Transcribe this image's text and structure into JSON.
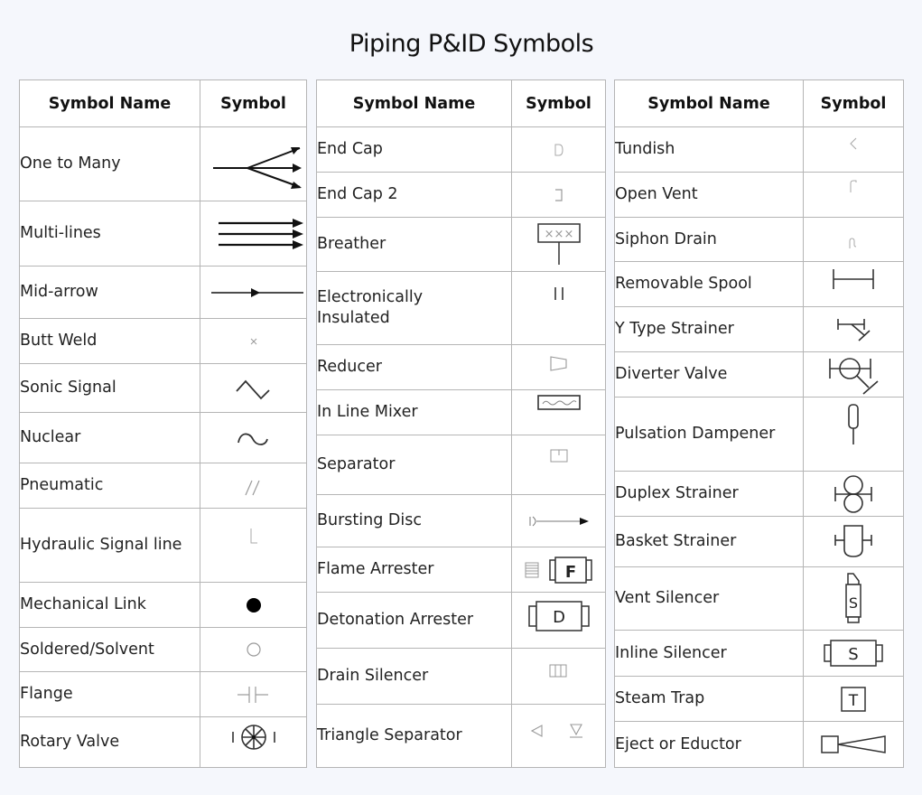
{
  "title": "Piping P&ID Symbols",
  "headers": {
    "name": "Symbol Name",
    "symbol": "Symbol"
  },
  "tables": [
    {
      "rows": [
        {
          "name": "One to Many",
          "icon": "one-to-many-icon"
        },
        {
          "name": "Multi-lines",
          "icon": "multi-lines-icon"
        },
        {
          "name": "Mid-arrow",
          "icon": "mid-arrow-icon"
        },
        {
          "name": "Butt Weld",
          "icon": "butt-weld-icon"
        },
        {
          "name": "Sonic Signal",
          "icon": "sonic-signal-icon"
        },
        {
          "name": "Nuclear",
          "icon": "nuclear-icon"
        },
        {
          "name": "Pneumatic",
          "icon": "pneumatic-icon"
        },
        {
          "name": "Hydraulic Signal line",
          "icon": "hydraulic-signal-line-icon"
        },
        {
          "name": "Mechanical Link",
          "icon": "mechanical-link-icon"
        },
        {
          "name": "Soldered/Solvent",
          "icon": "soldered-solvent-icon"
        },
        {
          "name": "Flange",
          "icon": "flange-icon"
        },
        {
          "name": "Rotary Valve",
          "icon": "rotary-valve-icon"
        }
      ]
    },
    {
      "rows": [
        {
          "name": "End Cap",
          "icon": "end-cap-icon"
        },
        {
          "name": "End Cap 2",
          "icon": "end-cap-2-icon"
        },
        {
          "name": "Breather",
          "icon": "breather-icon",
          "glyph": "×××"
        },
        {
          "name": "Electronically\nInsulated",
          "icon": "electronically-insulated-icon"
        },
        {
          "name": "Reducer",
          "icon": "reducer-icon"
        },
        {
          "name": "In Line Mixer",
          "icon": "in-line-mixer-icon"
        },
        {
          "name": "Separator",
          "icon": "separator-icon"
        },
        {
          "name": "Bursting Disc",
          "icon": "bursting-disc-icon"
        },
        {
          "name": "Flame Arrester",
          "icon": "flame-arrester-icon",
          "glyph": "F"
        },
        {
          "name": "Detonation Arrester",
          "icon": "detonation-arrester-icon",
          "glyph": "D"
        },
        {
          "name": "Drain Silencer",
          "icon": "drain-silencer-icon"
        },
        {
          "name": "Triangle Separator",
          "icon": "triangle-separator-icon"
        }
      ]
    },
    {
      "rows": [
        {
          "name": "Tundish",
          "icon": "tundish-icon"
        },
        {
          "name": "Open Vent",
          "icon": "open-vent-icon"
        },
        {
          "name": "Siphon Drain",
          "icon": "siphon-drain-icon"
        },
        {
          "name": "Removable Spool",
          "icon": "removable-spool-icon"
        },
        {
          "name": "Y Type Strainer",
          "icon": "y-type-strainer-icon"
        },
        {
          "name": "Diverter Valve",
          "icon": "diverter-valve-icon"
        },
        {
          "name": "Pulsation Dampener",
          "icon": "pulsation-dampener-icon"
        },
        {
          "name": "Duplex Strainer",
          "icon": "duplex-strainer-icon"
        },
        {
          "name": "Basket Strainer",
          "icon": "basket-strainer-icon"
        },
        {
          "name": "Vent Silencer",
          "icon": "vent-silencer-icon",
          "glyph": "S"
        },
        {
          "name": "Inline Silencer",
          "icon": "inline-silencer-icon",
          "glyph": "S"
        },
        {
          "name": "Steam Trap",
          "icon": "steam-trap-icon",
          "glyph": "T"
        },
        {
          "name": "Eject or Eductor",
          "icon": "eject-or-eductor-icon"
        }
      ]
    }
  ]
}
